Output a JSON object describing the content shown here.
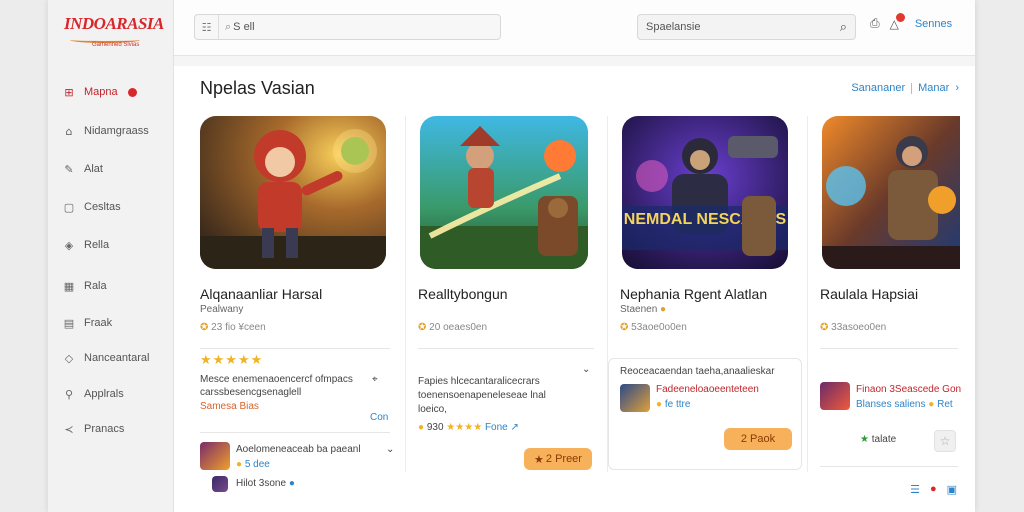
{
  "app": {
    "logo_text": "INDOARASIA",
    "logo_tagline": "Gamenned Sivias"
  },
  "sidebar": {
    "items": [
      {
        "label": "Mapna",
        "icon": "grid-icon"
      },
      {
        "label": "Nidamgraass",
        "icon": "library-icon"
      },
      {
        "label": "Alat",
        "icon": "pencil-icon"
      },
      {
        "label": "Cesltas",
        "icon": "bag-icon"
      },
      {
        "label": "Rella",
        "icon": "shield-icon"
      },
      {
        "label": "Rala",
        "icon": "calendar-icon"
      },
      {
        "label": "Fraak",
        "icon": "folder-icon"
      },
      {
        "label": "Nanceantaral",
        "icon": "tag-icon"
      },
      {
        "label": "Applrals",
        "icon": "tool-icon"
      },
      {
        "label": "Pranacs",
        "icon": "share-icon"
      }
    ]
  },
  "topbar": {
    "search_value": "S ell",
    "search2_value": "Spaelansie",
    "settings_label": "Sennes"
  },
  "main": {
    "title": "Npelas Vasian",
    "link1": "Sanananer",
    "link2": "Manar",
    "games": [
      {
        "title": "Alqanaanliar Harsal",
        "sub": "Pealwany",
        "rating": "23 fio ¥ceen",
        "stars": "★★★★★",
        "desc1": "Mesce enemenaoencercf ofmpacs",
        "desc2": "carssbesencgsenaglell",
        "desc3": "Samesa Bias",
        "link": "Con",
        "sub_title": "Aoelomeneaceab ba paeanl",
        "sub_meta": "5 dee",
        "sub_meta2": "Hilot 3sone"
      },
      {
        "title": "Realltybongun",
        "rating": "20 oeaes0en",
        "desc1": "Fapies hlcecantaralicecrars",
        "desc2": "toenensoenapeneleseae lnal",
        "desc3": "loeico,",
        "meta_count": "930",
        "meta_stars": "★★★★",
        "meta_tag": "Fone",
        "button": "2 Preer"
      },
      {
        "title": "Nephania Rgent Alatlan",
        "sub": "Staenen",
        "rating": "53aoe0o0en",
        "desc1": "Reoceacaendan taeha,anaalieskar",
        "sub_title": "Fadeeneloaoeenteteen",
        "sub_meta": "fe ttre",
        "button": "2 Paok",
        "logo_overlay": "NEMDAL NESCANAS"
      },
      {
        "title": "Raulala Hapsiai",
        "rating": "33asoeo0en",
        "sub_title": "Finaon 3Seascede Gon",
        "sub_meta": "Blanses saliens",
        "sub_meta2": "Ret",
        "tag": "talate"
      }
    ]
  },
  "colors": {
    "accent": "#d9262b",
    "link": "#2e84c8",
    "button": "#f7b15a",
    "star": "#f0b323"
  }
}
